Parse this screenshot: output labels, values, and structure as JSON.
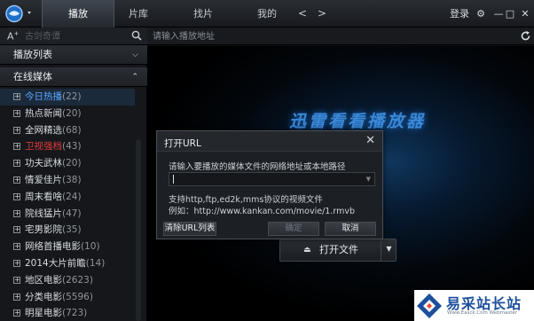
{
  "titlebar": {
    "tabs": [
      "播放",
      "片库",
      "找片",
      "我的"
    ],
    "nav_arrows": "< >",
    "login": "登录",
    "win_buttons": [
      "⚙",
      "—",
      "□",
      "✕"
    ]
  },
  "left_panel": {
    "font_button": "A",
    "font_button_sup": "+",
    "search_placeholder": "古剑奇谭",
    "sections": {
      "playlist": "播放列表",
      "online": "在线媒体"
    },
    "items": [
      {
        "label": "今日热播",
        "count": "(22)",
        "state": "selected"
      },
      {
        "label": "热点新闻",
        "count": "(20)",
        "state": ""
      },
      {
        "label": "全网精选",
        "count": "(68)",
        "state": ""
      },
      {
        "label": "卫视强档",
        "count": "(43)",
        "state": "hot"
      },
      {
        "label": "功夫武林",
        "count": "(20)",
        "state": ""
      },
      {
        "label": "情爱佳片",
        "count": "(38)",
        "state": ""
      },
      {
        "label": "周末看啥",
        "count": "(24)",
        "state": ""
      },
      {
        "label": "院线猛片",
        "count": "(47)",
        "state": ""
      },
      {
        "label": "宅男影院",
        "count": "(35)",
        "state": ""
      },
      {
        "label": "网络首播电影",
        "count": "(10)",
        "state": ""
      },
      {
        "label": "2014大片前瞻",
        "count": "(14)",
        "state": ""
      },
      {
        "label": "地区电影",
        "count": "(2623)",
        "state": ""
      },
      {
        "label": "分类电影",
        "count": "(5596)",
        "state": ""
      },
      {
        "label": "明星电影",
        "count": "(723)",
        "state": ""
      }
    ]
  },
  "address_bar": {
    "placeholder": "请输入播放地址"
  },
  "player": {
    "brand_text": "迅雷看看播放器",
    "open_file_label": "打开文件"
  },
  "dialog": {
    "title": "打开URL",
    "prompt": "请输入要播放的媒体文件的网络地址或本地路径",
    "url_value": "",
    "hint_protocols": "支持http,ftp,ed2k,mms协议的视频文件",
    "hint_example": "例如：http://www.kankan.com/movie/1.rmvb",
    "clear_button": "清除URL列表",
    "ok_button": "确定",
    "cancel_button": "取消"
  },
  "watermark": {
    "text": "易采站长站",
    "url": "Www.Easck.Com Webmaster"
  }
}
